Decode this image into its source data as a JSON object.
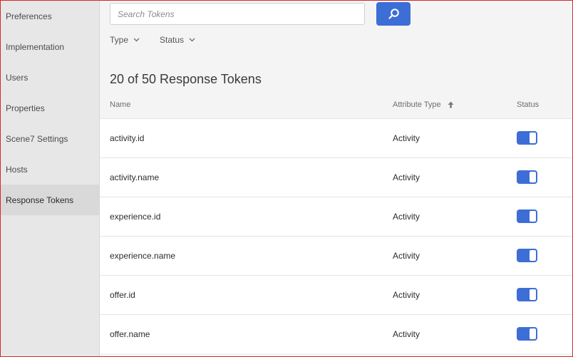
{
  "sidebar": {
    "items": [
      {
        "label": "Preferences",
        "active": false
      },
      {
        "label": "Implementation",
        "active": false
      },
      {
        "label": "Users",
        "active": false
      },
      {
        "label": "Properties",
        "active": false
      },
      {
        "label": "Scene7 Settings",
        "active": false
      },
      {
        "label": "Hosts",
        "active": false
      },
      {
        "label": "Response Tokens",
        "active": true
      }
    ]
  },
  "search": {
    "placeholder": "Search Tokens",
    "value": ""
  },
  "filters": {
    "type_label": "Type",
    "status_label": "Status"
  },
  "summary": {
    "title": "20 of 50 Response Tokens"
  },
  "table": {
    "columns": {
      "name": "Name",
      "attribute_type": "Attribute Type",
      "status": "Status"
    },
    "sort_column": "attribute_type",
    "sort_direction": "ascending",
    "rows": [
      {
        "name": "activity.id",
        "attribute_type": "Activity",
        "enabled": true
      },
      {
        "name": "activity.name",
        "attribute_type": "Activity",
        "enabled": true
      },
      {
        "name": "experience.id",
        "attribute_type": "Activity",
        "enabled": true
      },
      {
        "name": "experience.name",
        "attribute_type": "Activity",
        "enabled": true
      },
      {
        "name": "offer.id",
        "attribute_type": "Activity",
        "enabled": true
      },
      {
        "name": "offer.name",
        "attribute_type": "Activity",
        "enabled": true
      }
    ]
  },
  "icons": {
    "search": "search-icon",
    "chevron": "chevron-down-icon",
    "sort": "sort-arrow-up-icon"
  },
  "colors": {
    "accent": "#3d6ed6",
    "frame_border": "#d22b2b",
    "sidebar_bg": "#e7e7e7",
    "sidebar_active_bg": "#d9d9d9"
  }
}
